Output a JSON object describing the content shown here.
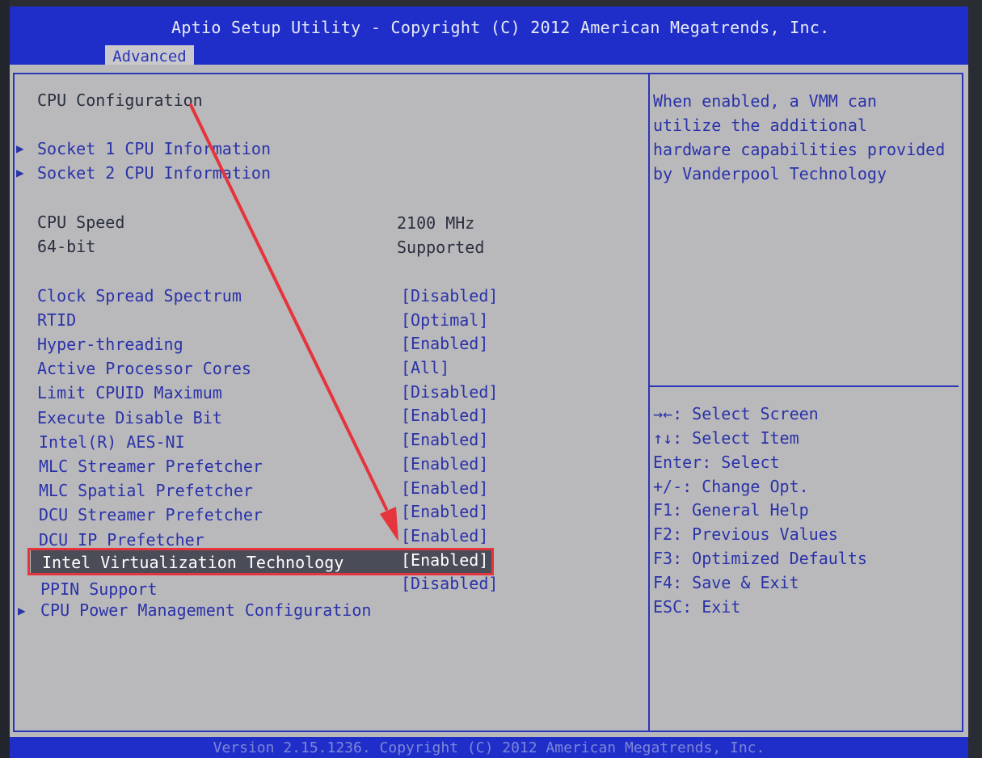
{
  "header": {
    "title": "Aptio Setup Utility - Copyright (C) 2012 American Megatrends, Inc.",
    "active_tab": "Advanced"
  },
  "section_title": "CPU Configuration",
  "submenus": [
    {
      "label": "Socket 1 CPU Information"
    },
    {
      "label": "Socket 2 CPU Information"
    }
  ],
  "info": [
    {
      "label": "CPU Speed",
      "value": "2100 MHz"
    },
    {
      "label": "64-bit",
      "value": "Supported"
    }
  ],
  "settings": [
    {
      "label": "Clock Spread Spectrum",
      "value": "[Disabled]"
    },
    {
      "label": "RTID",
      "value": "[Optimal]"
    },
    {
      "label": "Hyper-threading",
      "value": "[Enabled]"
    },
    {
      "label": "Active Processor Cores",
      "value": "[All]"
    },
    {
      "label": "Limit CPUID Maximum",
      "value": "[Disabled]"
    },
    {
      "label": "Execute Disable Bit",
      "value": "[Enabled]"
    },
    {
      "label": "Intel(R) AES-NI",
      "value": "[Enabled]"
    },
    {
      "label": "MLC Streamer Prefetcher",
      "value": "[Enabled]"
    },
    {
      "label": "MLC Spatial Prefetcher",
      "value": "[Enabled]"
    },
    {
      "label": "DCU Streamer Prefetcher",
      "value": "[Enabled]"
    },
    {
      "label": "DCU IP Prefetcher",
      "value": "[Enabled]"
    },
    {
      "label": "Intel Virtualization Technology",
      "value": "[Enabled]"
    },
    {
      "label": "PPIN Support",
      "value": "[Disabled]"
    }
  ],
  "bottom_submenu": "CPU Power Management Configuration",
  "help": [
    "When enabled, a VMM can",
    "utilize the additional",
    "hardware capabilities provided",
    "by Vanderpool Technology"
  ],
  "keys": [
    "→←: Select Screen",
    "↑↓: Select Item",
    "Enter: Select",
    "+/-: Change Opt.",
    "F1: General Help",
    "F2: Previous Values",
    "F3: Optimized Defaults",
    "F4: Save & Exit",
    "ESC: Exit"
  ],
  "footer": "Version 2.15.1236. Copyright (C) 2012 American Megatrends, Inc.",
  "colors": {
    "bios_blue": "#1f2ec9",
    "panel_gray": "#b9b9bc",
    "annotation_red": "#e5343b"
  },
  "icons": {
    "submenu": "triangle-right-icon",
    "annotation": "red-arrow"
  }
}
